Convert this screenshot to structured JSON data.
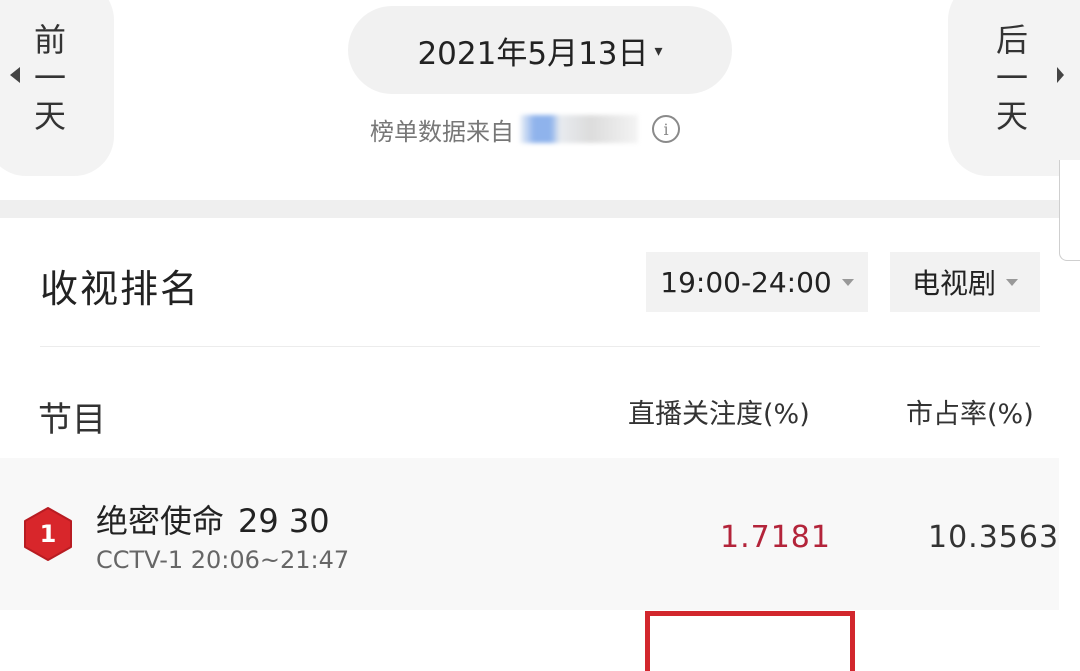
{
  "nav": {
    "prev_label": [
      "前",
      "一",
      "天"
    ],
    "next_label": [
      "后",
      "一",
      "天"
    ]
  },
  "date": {
    "value": "2021年5月13日",
    "caret": "▾"
  },
  "source": {
    "prefix": "榜单数据来自",
    "info_icon": "info-icon"
  },
  "ranking": {
    "title": "收视排名",
    "time_filter": "19:00-24:00",
    "type_filter": "电视剧"
  },
  "table": {
    "headers": {
      "program": "节目",
      "attention": "直播关注度(%)",
      "share": "市占率(%)"
    },
    "rows": [
      {
        "rank": "1",
        "title": "绝密使命",
        "episodes": "29 30",
        "channel_time": "CCTV-1 20:06~21:47",
        "attention": "1.7181",
        "share": "10.3563"
      }
    ]
  },
  "colors": {
    "accent_red": "#b3243a",
    "badge_red": "#d8262b",
    "highlight_border": "#d2272d"
  }
}
